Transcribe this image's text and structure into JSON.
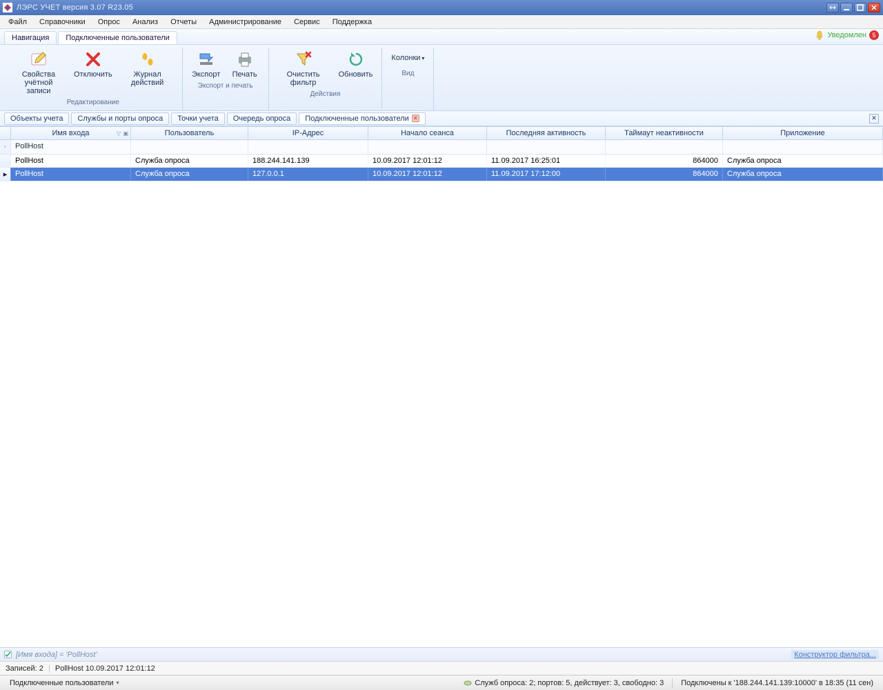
{
  "title": "ЛЭРС УЧЕТ версия 3.07 R23.05",
  "menu": [
    "Файл",
    "Справочники",
    "Опрос",
    "Анализ",
    "Отчеты",
    "Администрирование",
    "Сервис",
    "Поддержка"
  ],
  "top_tabs": {
    "items": [
      "Навигация",
      "Подключенные пользователи"
    ],
    "active": 1
  },
  "notification": {
    "label": "Уведомлен",
    "count": "5"
  },
  "ribbon": {
    "groups": [
      {
        "label": "Редактирование",
        "buttons": [
          {
            "id": "props",
            "label": "Свойства\nучётной записи"
          },
          {
            "id": "disconnect",
            "label": "Отключить"
          },
          {
            "id": "journal",
            "label": "Журнал\nдействий"
          }
        ]
      },
      {
        "label": "Экспорт и печать",
        "buttons": [
          {
            "id": "export",
            "label": "Экспорт"
          },
          {
            "id": "print",
            "label": "Печать"
          }
        ]
      },
      {
        "label": "Действия",
        "buttons": [
          {
            "id": "clearfilter",
            "label": "Очистить\nфильтр"
          },
          {
            "id": "refresh",
            "label": "Обновить"
          }
        ]
      },
      {
        "label": "Вид",
        "buttons": [
          {
            "id": "columns",
            "label": "Колонки",
            "dropdown": true
          }
        ]
      }
    ]
  },
  "sub_tabs": {
    "items": [
      "Объекты учета",
      "Службы и порты опроса",
      "Точки учета",
      "Очередь опроса",
      "Подключенные пользователи"
    ],
    "active": 4,
    "closable_active": true
  },
  "grid": {
    "columns": [
      "Имя входа",
      "Пользователь",
      "IP-Адрес",
      "Начало сеанса",
      "Последняя активность",
      "Таймаут неактивности",
      "Приложение"
    ],
    "sort_col": 0,
    "sort_dir": "desc",
    "filter_row": {
      "login": "PollHost"
    },
    "rows": [
      {
        "login": "PollHost",
        "user": "Служба опроса",
        "ip": "188.244.141.139",
        "start": "10.09.2017 12:01:12",
        "last": "11.09.2017 16:25:01",
        "timeout": "864000",
        "app": "Служба опроса",
        "selected": false
      },
      {
        "login": "PollHost",
        "user": "Служба опроса",
        "ip": "127.0.0.1",
        "start": "10.09.2017 12:01:12",
        "last": "11.09.2017 17:12:00",
        "timeout": "864000",
        "app": "Служба опроса",
        "selected": true
      }
    ]
  },
  "filterbar": {
    "checked": true,
    "expr": "[Имя входа] = 'PollHost'",
    "builder": "Конструктор фильтра..."
  },
  "records": {
    "count_label": "Записей: 2",
    "detail": "PollHost 10.09.2017 12:01:12"
  },
  "status": {
    "left": "Подключенные пользователи",
    "services": "Служб опроса: 2; портов: 5, действует: 3, свободно: 3",
    "conn": "Подключены к '188.244.141.139:10000' в 18:35 (11 сен)"
  }
}
